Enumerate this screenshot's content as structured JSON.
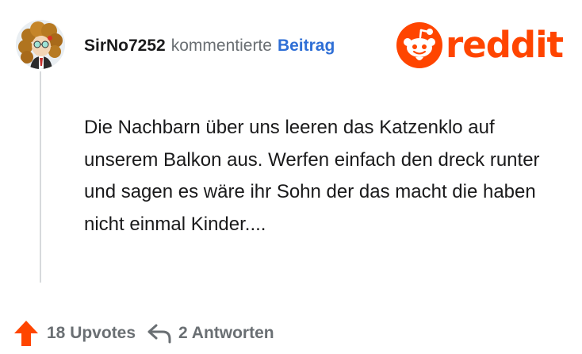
{
  "comment": {
    "username": "SirNo7252",
    "action_text": "kommentierte",
    "post_link": "Beitrag",
    "body": "Die Nachbarn über uns leeren das Katzenklo auf unserem Balkon aus. Werfen einfach den dreck runter und sagen es wäre ihr Sohn der das macht die haben nicht einmal Kinder....",
    "upvotes_label": "18 Upvotes",
    "replies_label": "2 Antworten"
  },
  "branding": {
    "wordmark": "reddit",
    "icon": "reddit-snoo-icon"
  },
  "colors": {
    "brand": "#ff4500",
    "link": "#2f6fd6",
    "text": "#1a1a1b",
    "muted": "#6a6f73",
    "thread_line": "#d7dadc"
  },
  "icons": {
    "upvote": "upvote-arrow-icon",
    "reply": "reply-arrow-icon"
  }
}
